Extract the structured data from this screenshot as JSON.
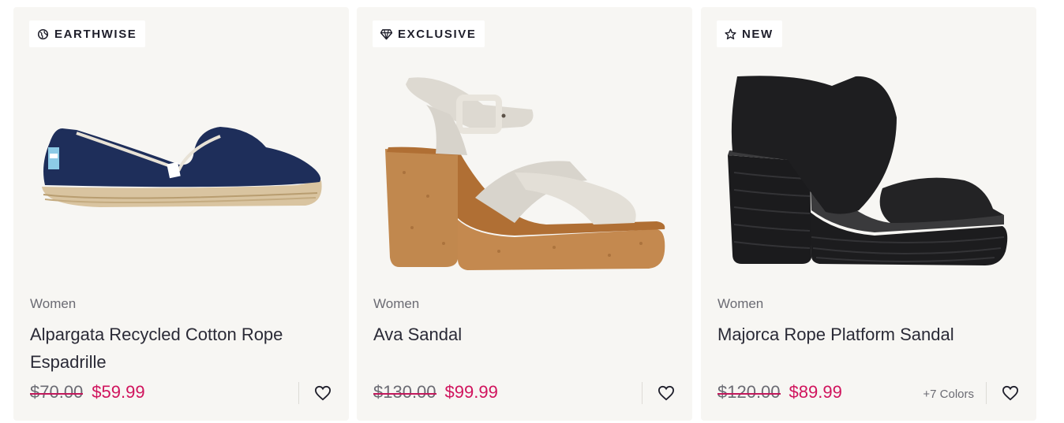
{
  "products": [
    {
      "badge": {
        "label": "EARTHWISE",
        "icon": "earth-leaf-icon"
      },
      "category": "Women",
      "title": "Alpargata Recycled Cotton Rope Espadrille",
      "old_price": "$70.00",
      "new_price": "$59.99",
      "colors": "",
      "image": "navy-espadrille-shoe"
    },
    {
      "badge": {
        "label": "EXCLUSIVE",
        "icon": "diamond-icon"
      },
      "category": "Women",
      "title": "Ava Sandal",
      "old_price": "$130.00",
      "new_price": "$99.99",
      "colors": "",
      "image": "cork-platform-sandal"
    },
    {
      "badge": {
        "label": "NEW",
        "icon": "star-icon"
      },
      "category": "Women",
      "title": "Majorca Rope Platform Sandal",
      "old_price": "$120.00",
      "new_price": "$89.99",
      "colors": "+7 Colors",
      "image": "black-rope-platform-sandal"
    }
  ],
  "colors": {
    "card_bg": "#f7f6f3",
    "sale_price": "#d0145d",
    "strike": "#c2185b",
    "text": "#1f1f2b",
    "muted": "#6b6b73"
  }
}
